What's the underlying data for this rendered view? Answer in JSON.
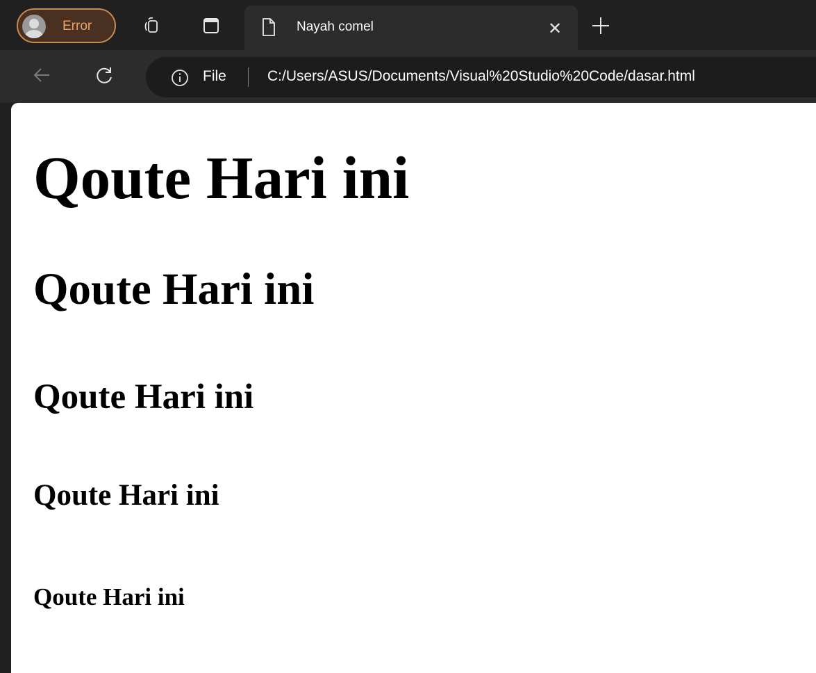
{
  "browser": {
    "profile": {
      "label": "Error",
      "accent": "#c98a4f"
    },
    "tabs": [
      {
        "title": "Nayah comel",
        "active": true,
        "icon": "page-icon"
      }
    ],
    "toolbar_icons": [
      "workspaces-icon",
      "tab-actions-icon",
      "back-icon",
      "refresh-icon",
      "new-tab-icon",
      "close-icon",
      "info-icon"
    ],
    "address_bar": {
      "scheme_label": "File",
      "url": "C:/Users/ASUS/Documents/Visual%20Studio%20Code/dasar.html"
    },
    "theme": {
      "tabstrip_bg": "#202020",
      "toolbar_bg": "#2c2c2c",
      "omnibox_bg": "#1c1c1c"
    }
  },
  "page": {
    "headings": {
      "h1": "Qoute Hari ini",
      "h2": "Qoute Hari ini",
      "h3": "Qoute Hari ini",
      "h4": "Qoute Hari ini",
      "h5": "Qoute Hari ini"
    }
  }
}
